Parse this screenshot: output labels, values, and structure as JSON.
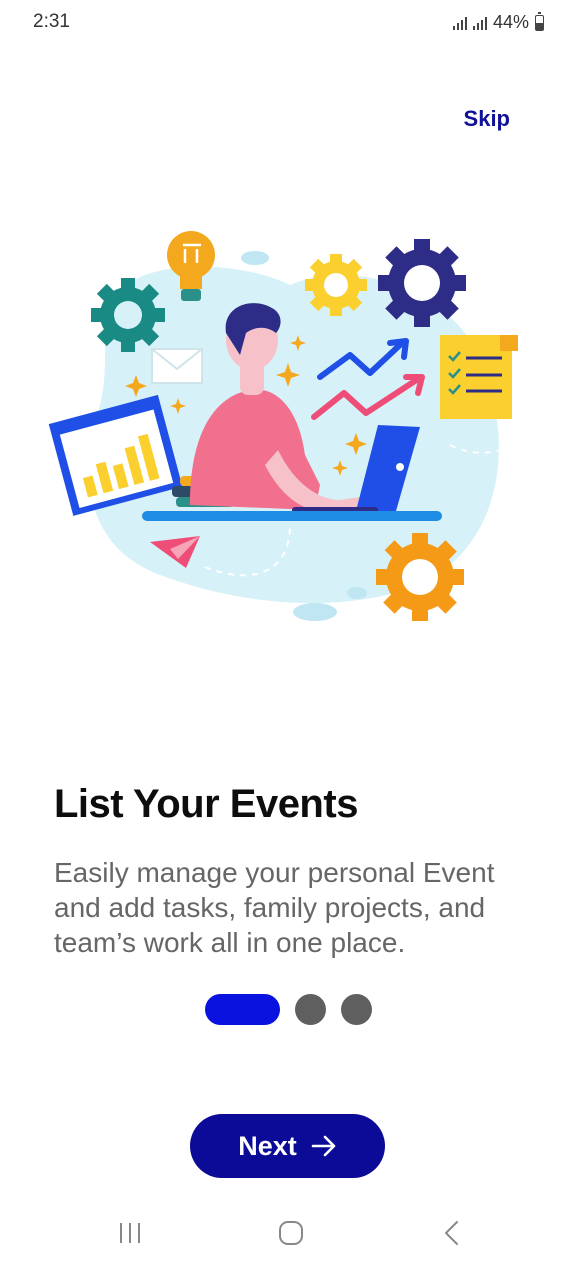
{
  "status_bar": {
    "time": "2:31",
    "battery": "44%",
    "icons": [
      "signal-icon",
      "signal-icon",
      "battery-icon"
    ]
  },
  "header": {
    "skip_label": "Skip"
  },
  "onboarding": {
    "title": "List Your Events",
    "description": "Easily manage your personal Event and add tasks, family projects, and team’s work all in one place.",
    "current_page": 1,
    "page_count": 3
  },
  "footer": {
    "next_label": "Next",
    "next_icon": "arrow-right-icon"
  },
  "nav_bar": {
    "items": [
      "recent-apps-icon",
      "home-icon",
      "back-icon"
    ]
  },
  "colors": {
    "primary": "#0c0b97",
    "indicator_active": "#0a12e0",
    "indicator_inactive": "#5f5f5f",
    "skip_text": "#10109a",
    "description_text": "#666666"
  }
}
